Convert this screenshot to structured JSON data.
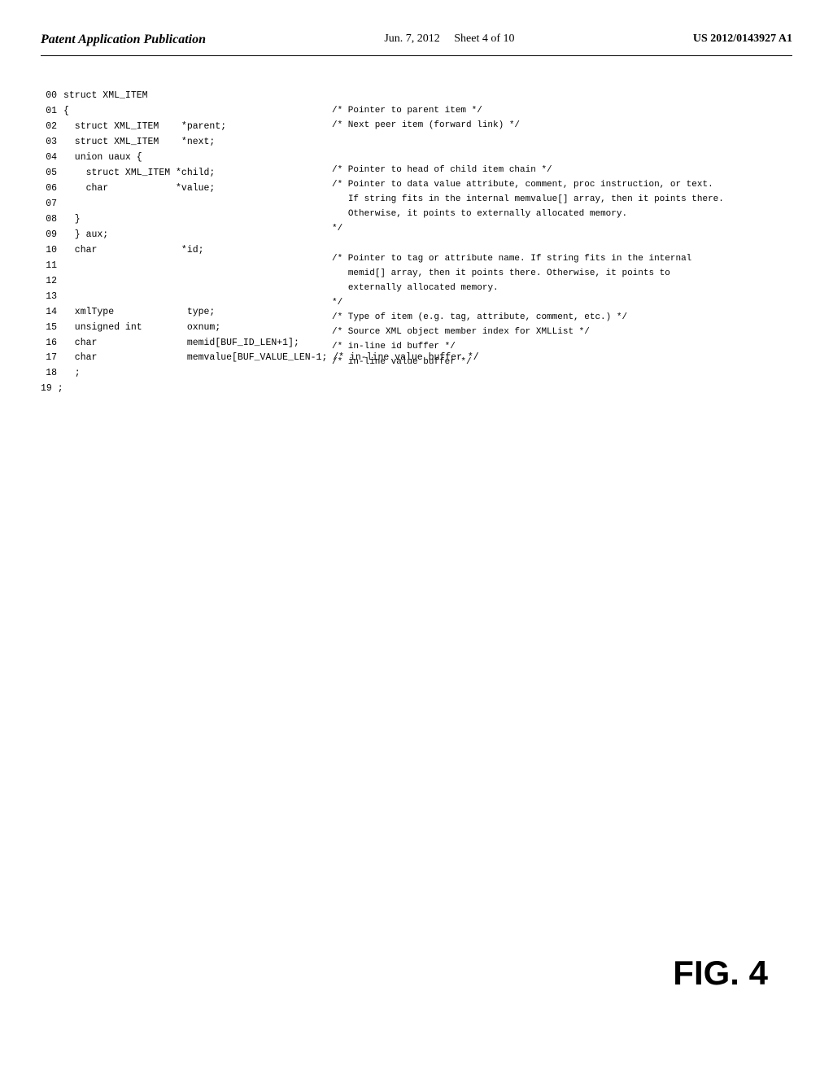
{
  "header": {
    "left_title": "Patent Application Publication",
    "center_date": "Jun. 7, 2012",
    "center_sheet": "Sheet 4 of 10",
    "right_patent": "US 2012/0143927 A1"
  },
  "figure_label": "FIG. 4",
  "line_numbers": [
    "00",
    "01",
    "02",
    "03",
    "04",
    "05",
    "06",
    "07",
    "08",
    "09",
    "10",
    "11",
    "12",
    "13",
    "14",
    "15",
    "16",
    "17",
    "18",
    "19"
  ],
  "code_lines": [
    "struct XML_ITEM",
    "{",
    "  struct XML_ITEM    *parent;",
    "  struct XML_ITEM    *next;",
    "  union uaux {",
    "    struct XML_ITEM *child;",
    "    char            *value;",
    "",
    "  }",
    "  } aux;",
    "  char               *id;",
    "",
    "",
    "",
    "  xmlType             type;",
    "  unsigned int        oxnum;",
    "  char                memid[BUF_ID_LEN+1];",
    "  char                memvalue[BUF_VALUE_LEN-1; /* in-line value buffer */",
    "  ;",
    ""
  ],
  "comments": [
    "/* Pointer to parent item */",
    "/* Next peer item (forward link) */",
    "",
    "/* Pointer to head of child item chain */",
    "/* Pointer to data value attribute, comment, proc instruction, or text.",
    "   If string fits in the internal memvalue[] array, then it points there.",
    "   Otherwise, it points to externally allocated memory.",
    "*/",
    "",
    "/* Pointer to tag or attribute name. If string fits in the internal",
    "   memid[] array, then it points there. Otherwise, it points to",
    "   externally allocated memory.",
    "*/",
    "/* Type of item (e.g. tag, attribute, comment, etc.) */",
    "/* Source XML object member index for XMLList */",
    "/* in-line id buffer */",
    "/* in-line value buffer */"
  ]
}
